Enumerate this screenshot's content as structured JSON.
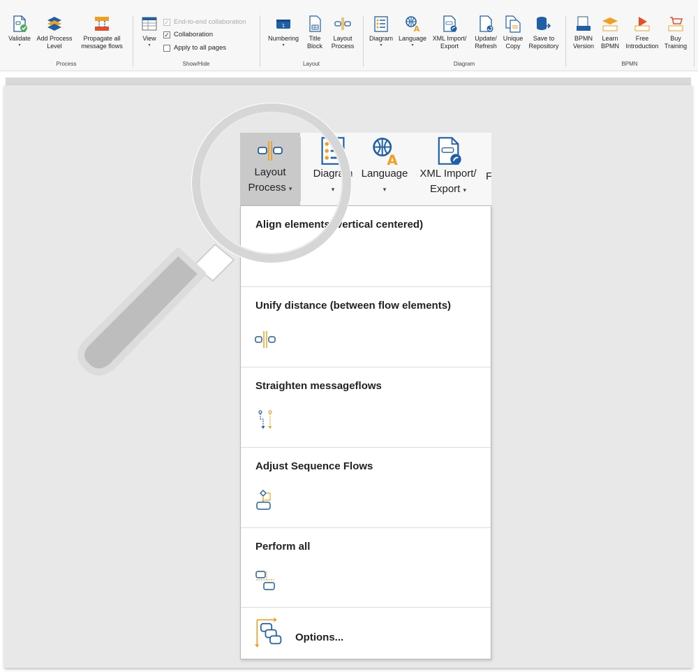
{
  "ribbon": {
    "groups": {
      "process": {
        "label": "Process",
        "validate": "Validate",
        "add_process_level": [
          "Add Process",
          "Level"
        ],
        "propagate": [
          "Propagate all",
          "message flows"
        ]
      },
      "show_hide": {
        "label": "Show/Hide",
        "view": "View",
        "end_to_end": "End-to-end collaboration",
        "collaboration": "Collaboration",
        "apply_all": "Apply to all pages"
      },
      "layout": {
        "label": "Layout",
        "numbering": "Numbering",
        "title_block": [
          "Title",
          "Block"
        ],
        "layout_process": [
          "Layout",
          "Process"
        ]
      },
      "diagram": {
        "label": "Diagram",
        "diagram": "Diagram",
        "language": "Language",
        "xml": [
          "XML Import/",
          "Export"
        ],
        "update_refresh": [
          "Update/",
          "Refresh"
        ],
        "unique_copy": [
          "Unique",
          "Copy"
        ],
        "save_repo": [
          "Save to",
          "Repository"
        ]
      },
      "bpmn": {
        "label": "BPMN",
        "bpmn_version": [
          "BPMN",
          "Version"
        ],
        "learn_bpmn": [
          "Learn",
          "BPMN"
        ],
        "free_intro": [
          "Free",
          "Introduction"
        ],
        "buy_training": [
          "Buy",
          "Training"
        ]
      }
    },
    "dropdown_glyph": "▾",
    "checkmark": "✓",
    "accent_blue": "#1f5fa8",
    "accent_orange": "#f0a020"
  },
  "zoom": {
    "layout_process": [
      "Layout",
      "Process"
    ],
    "diagram": "Diagram",
    "language": "Language",
    "xml": [
      "XML Import/",
      "Export"
    ],
    "partial": "F"
  },
  "menu": {
    "items": [
      {
        "title": "Align elements (vertical centered)",
        "icon": "align-icon"
      },
      {
        "title": "Unify distance (between flow elements)",
        "icon": "unify-distance-icon"
      },
      {
        "title": "Straighten messageflows",
        "icon": "straighten-icon"
      },
      {
        "title": "Adjust Sequence Flows",
        "icon": "sequence-flow-icon"
      },
      {
        "title": "Perform all",
        "icon": "perform-all-icon"
      }
    ],
    "options": "Options..."
  }
}
